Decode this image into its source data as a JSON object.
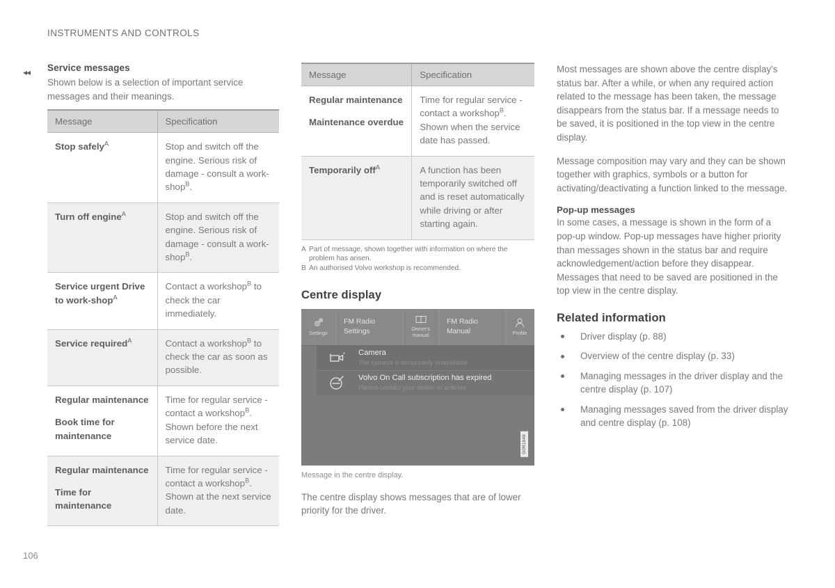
{
  "page": {
    "running_header": "INSTRUMENTS AND CONTROLS",
    "page_number": "106",
    "continuation_marker": "◂◂"
  },
  "column1": {
    "section_title": "Service messages",
    "intro": "Shown below is a selection of important service messages and their meanings.",
    "table": {
      "headers": [
        "Message",
        "Specification"
      ],
      "rows": [
        {
          "message": "Stop safely",
          "message_sup": "A",
          "message2": "",
          "spec": "Stop and switch off the engine. Serious risk of damage - consult a work-shop",
          "spec_sup": "B",
          "spec_tail": ".",
          "shaded": false
        },
        {
          "message": "Turn off engine",
          "message_sup": "A",
          "message2": "",
          "spec": "Stop and switch off the engine. Serious risk of damage - consult a work-shop",
          "spec_sup": "B",
          "spec_tail": ".",
          "shaded": true
        },
        {
          "message": "Service urgent Drive to work-shop",
          "message_sup": "A",
          "message2": "",
          "spec": "Contact a workshop",
          "spec_sup": "B",
          "spec_tail": " to check the car immediately.",
          "shaded": false
        },
        {
          "message": "Service required",
          "message_sup": "A",
          "message2": "",
          "spec": "Contact a workshop",
          "spec_sup": "B",
          "spec_tail": " to check the car as soon as possible.",
          "shaded": true
        },
        {
          "message": "Regular maintenance",
          "message_sup": "",
          "message2": "Book time for maintenance",
          "spec": "Time for regular service - contact a workshop",
          "spec_sup": "B",
          "spec_tail": ". Shown before the next service date.",
          "shaded": false
        },
        {
          "message": "Regular maintenance",
          "message_sup": "",
          "message2": "Time for maintenance",
          "spec": "Time for regular service - contact a workshop",
          "spec_sup": "B",
          "spec_tail": ". Shown at the next service date.",
          "shaded": true
        }
      ]
    }
  },
  "column2": {
    "table": {
      "headers": [
        "Message",
        "Specification"
      ],
      "rows": [
        {
          "message": "Regular maintenance",
          "message_sup": "",
          "message2": "Maintenance overdue",
          "spec": "Time for regular service - contact a workshop",
          "spec_sup": "B",
          "spec_tail": ". Shown when the service date has passed.",
          "shaded": false
        },
        {
          "message": "Temporarily off",
          "message_sup": "A",
          "message2": "",
          "spec": "A function has been temporarily switched off and is reset automatically while driving or after starting again.",
          "spec_sup": "",
          "spec_tail": "",
          "shaded": true
        }
      ]
    },
    "footnotes": [
      {
        "mark": "A",
        "text": "Part of message, shown together with information on where the problem has arisen."
      },
      {
        "mark": "B",
        "text": "An authorised Volvo workshop is recommended."
      }
    ],
    "centre_display_title": "Centre display",
    "centre_display": {
      "tiles": [
        {
          "icon": "settings-icon",
          "label": "Settings",
          "text": ""
        },
        {
          "icon": "",
          "label": "",
          "text": "FM Radio\nSettings"
        },
        {
          "icon": "owners-manual-icon",
          "label": "Owner's\nmanual",
          "text": ""
        },
        {
          "icon": "",
          "label": "",
          "text": "FM Radio\nManual"
        },
        {
          "icon": "profile-icon",
          "label": "Profile",
          "text": ""
        }
      ],
      "messages": [
        {
          "icon": "camera-icon",
          "title": "Camera",
          "subtitle": "The camera is temporarily unavailable"
        },
        {
          "icon": "volvo-logo-icon",
          "title": "Volvo On Call subscription has expired",
          "subtitle": "Please contact your dealer to activate"
        }
      ],
      "watermark": "G0R1848"
    },
    "figure_caption": "Message in the centre display.",
    "after_figure_text": "The centre display shows messages that are of lower priority for the driver."
  },
  "column3": {
    "paragraph1": "Most messages are shown above the centre display's status bar. After a while, or when any required action related to the message has been taken, the message disappears from the status bar. If a message needs to be saved, it is positioned in the top view in the centre display.",
    "paragraph2": "Message composition may vary and they can be shown together with graphics, symbols or a button for activating/deactivating a function linked to the message.",
    "popup_title": "Pop-up messages",
    "popup_text": "In some cases, a message is shown in the form of a pop-up window. Pop-up messages have higher priority than messages shown in the status bar and require acknowledgement/action before they disappear. Messages that need to be saved are positioned in the top view in the centre display.",
    "related_title": "Related information",
    "related_items": [
      "Driver display (p. 88)",
      "Overview of the centre display (p. 33)",
      "Managing messages in the driver display and the centre display (p. 107)",
      "Managing messages saved from the driver display and centre display (p. 108)"
    ]
  },
  "colors": {
    "table_header_bg": "#d4d5d6",
    "table_shade_bg": "#eeeff0",
    "text": "#77797b",
    "heading": "#4c4e50",
    "display_bg": "#7a7c7e"
  }
}
